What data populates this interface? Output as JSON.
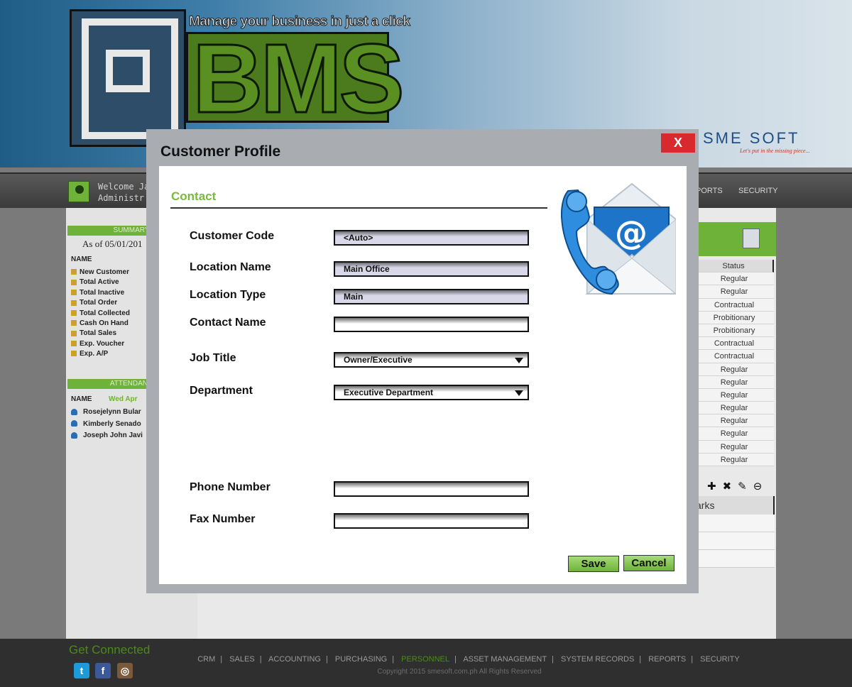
{
  "header": {
    "tagline": "Manage your business in just a click",
    "logo_text": "BMS",
    "partner_brand": "SME SOFT",
    "partner_slogan": "Let's put in the missing piece..."
  },
  "navbar": {
    "welcome_line1": "Welcome Ja",
    "welcome_line2": "Administr",
    "right_items": [
      "PORTS",
      "SECURITY"
    ]
  },
  "sidebar": {
    "summary_title": "SUMMARY",
    "as_of": "As of 05/01/201",
    "name_header": "NAME",
    "summary_items": [
      "New Customer",
      "Total Active",
      "Total Inactive",
      "Total Order",
      "Total Collected",
      "Cash On Hand",
      "Total Sales",
      "Exp. Voucher",
      "Exp. A/P"
    ],
    "attendance_title": "ATTENDANC",
    "attendance_name_header": "NAME",
    "attendance_date": "Wed Apr",
    "attendance_people": [
      "Rosejelynn Bular",
      "Kimberly Senado",
      "Joseph John Javi"
    ]
  },
  "employee_table": {
    "status_header": "Status",
    "statuses": [
      "Regular",
      "Regular",
      "Contractual",
      "Probitionary",
      "Probitionary",
      "Contractual",
      "Contractual",
      "Regular",
      "Regular",
      "Regular",
      "Regular",
      "Regular",
      "Regular",
      "Regular",
      "Regular"
    ],
    "remarks_header": "arks"
  },
  "footer": {
    "get_connected": "Get Connected",
    "links": [
      "CRM",
      "SALES",
      "ACCOUNTING",
      "PURCHASING",
      "PERSONNEL",
      "ASSET MANAGEMENT",
      "SYSTEM RECORDS",
      "REPORTS",
      "SECURITY"
    ],
    "active_link": "PERSONNEL",
    "copyright": "Copyright 2015  smesoft.com.ph  All Rights Reserved",
    "social": [
      "twitter-icon",
      "facebook-icon",
      "instagram-icon"
    ]
  },
  "modal": {
    "title": "Customer Profile",
    "close_label": "X",
    "section_title": "Contact",
    "fields": {
      "customer_code": {
        "label": "Customer Code",
        "value": "<Auto>"
      },
      "location_name": {
        "label": "Location Name",
        "value": "Main Office"
      },
      "location_type": {
        "label": "Location Type",
        "value": "Main"
      },
      "contact_name": {
        "label": "Contact Name",
        "value": ""
      },
      "job_title": {
        "label": "Job Title",
        "value": "Owner/Executive"
      },
      "department": {
        "label": "Department",
        "value": "Executive Department"
      },
      "phone_number": {
        "label": "Phone Number",
        "value": ""
      },
      "fax_number": {
        "label": "Fax Number",
        "value": ""
      }
    },
    "save_label": "Save",
    "cancel_label": "Cancel"
  },
  "colors": {
    "accent_green": "#7ab83f",
    "close_red": "#d8292e",
    "header_blue": "#1f5c86"
  }
}
